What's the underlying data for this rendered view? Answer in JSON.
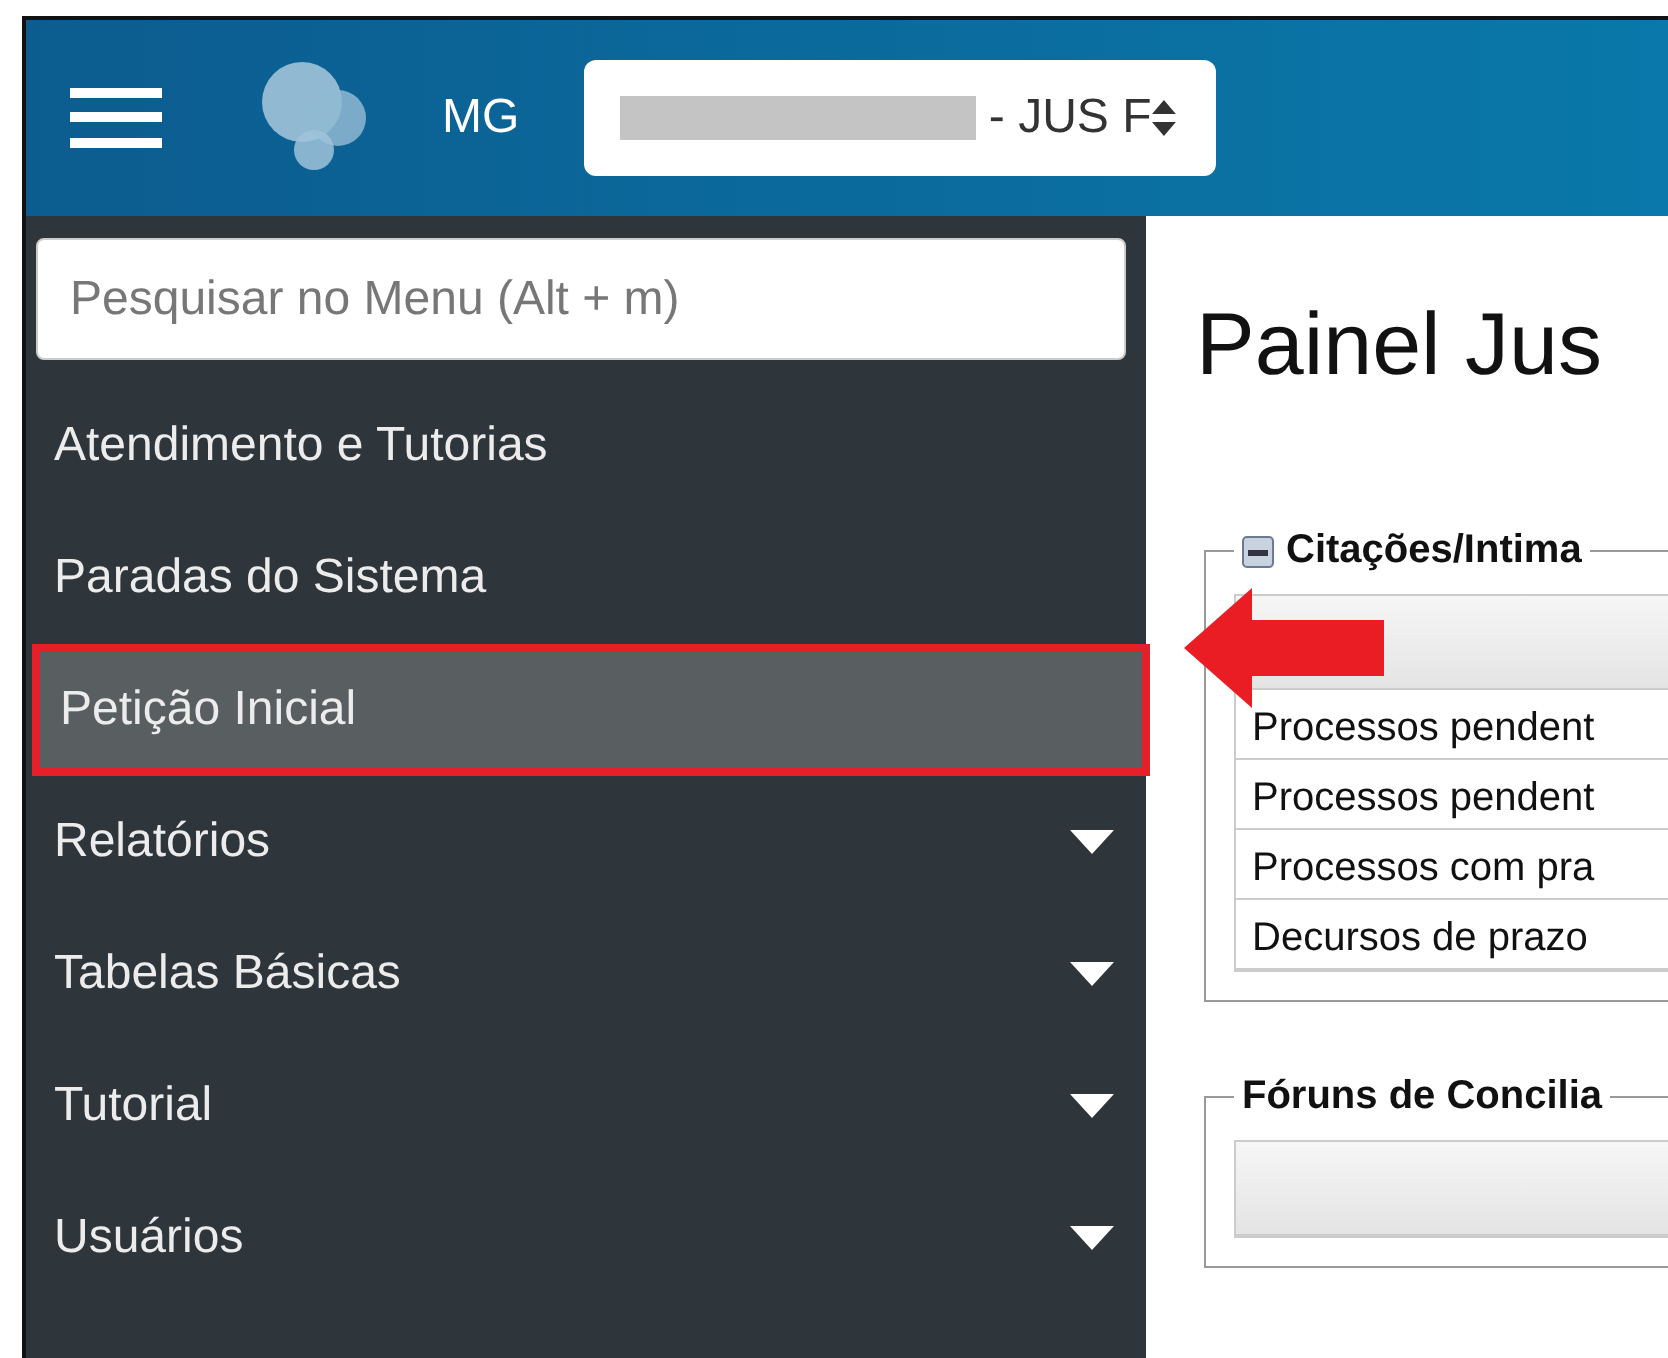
{
  "header": {
    "org": "MG",
    "selector": {
      "redacted": true,
      "text": "- JUS F"
    }
  },
  "sidebar": {
    "search": {
      "placeholder": "Pesquisar no Menu (Alt + m)"
    },
    "items": [
      {
        "label": "Atendimento e Tutorias",
        "selected": false,
        "expandable": false
      },
      {
        "label": "Paradas do Sistema",
        "selected": false,
        "expandable": false
      },
      {
        "label": "Petição Inicial",
        "selected": true,
        "expandable": false
      },
      {
        "label": "Relatórios",
        "selected": false,
        "expandable": true
      },
      {
        "label": "Tabelas Básicas",
        "selected": false,
        "expandable": true
      },
      {
        "label": "Tutorial",
        "selected": false,
        "expandable": true
      },
      {
        "label": "Usuários",
        "selected": false,
        "expandable": true
      }
    ]
  },
  "content": {
    "title": "Painel Jus",
    "panels": [
      {
        "legend": "Citações/Intima",
        "collapsible": true,
        "rows": [
          "Processos pendent",
          "Processos pendent",
          "Processos com pra",
          "Decursos de prazo"
        ]
      },
      {
        "legend": "Fóruns de Concilia",
        "collapsible": false
      }
    ]
  }
}
